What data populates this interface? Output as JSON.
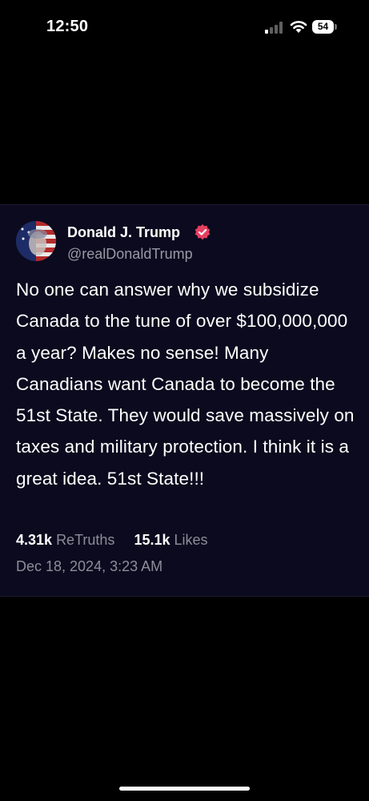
{
  "status_bar": {
    "time": "12:50",
    "battery_level": "54"
  },
  "post": {
    "author_name": "Donald J. Trump",
    "handle": "@realDonaldTrump",
    "verified_color": "#e4405f",
    "text": "No one can answer why we subsidize Canada to the tune of over $100,000,000 a year? Makes no sense! Many Canadians want Canada to become the 51st State. They would save massively on taxes and military protection. I think it is a great idea. 51st State!!!",
    "retruths_count": "4.31k",
    "retruths_label": "ReTruths",
    "likes_count": "15.1k",
    "likes_label": "Likes",
    "timestamp": "Dec 18, 2024, 3:23 AM"
  },
  "icons": {
    "signal": "cellular-signal-icon",
    "wifi": "wifi-icon",
    "battery": "battery-icon",
    "verified": "verified-badge-icon"
  }
}
